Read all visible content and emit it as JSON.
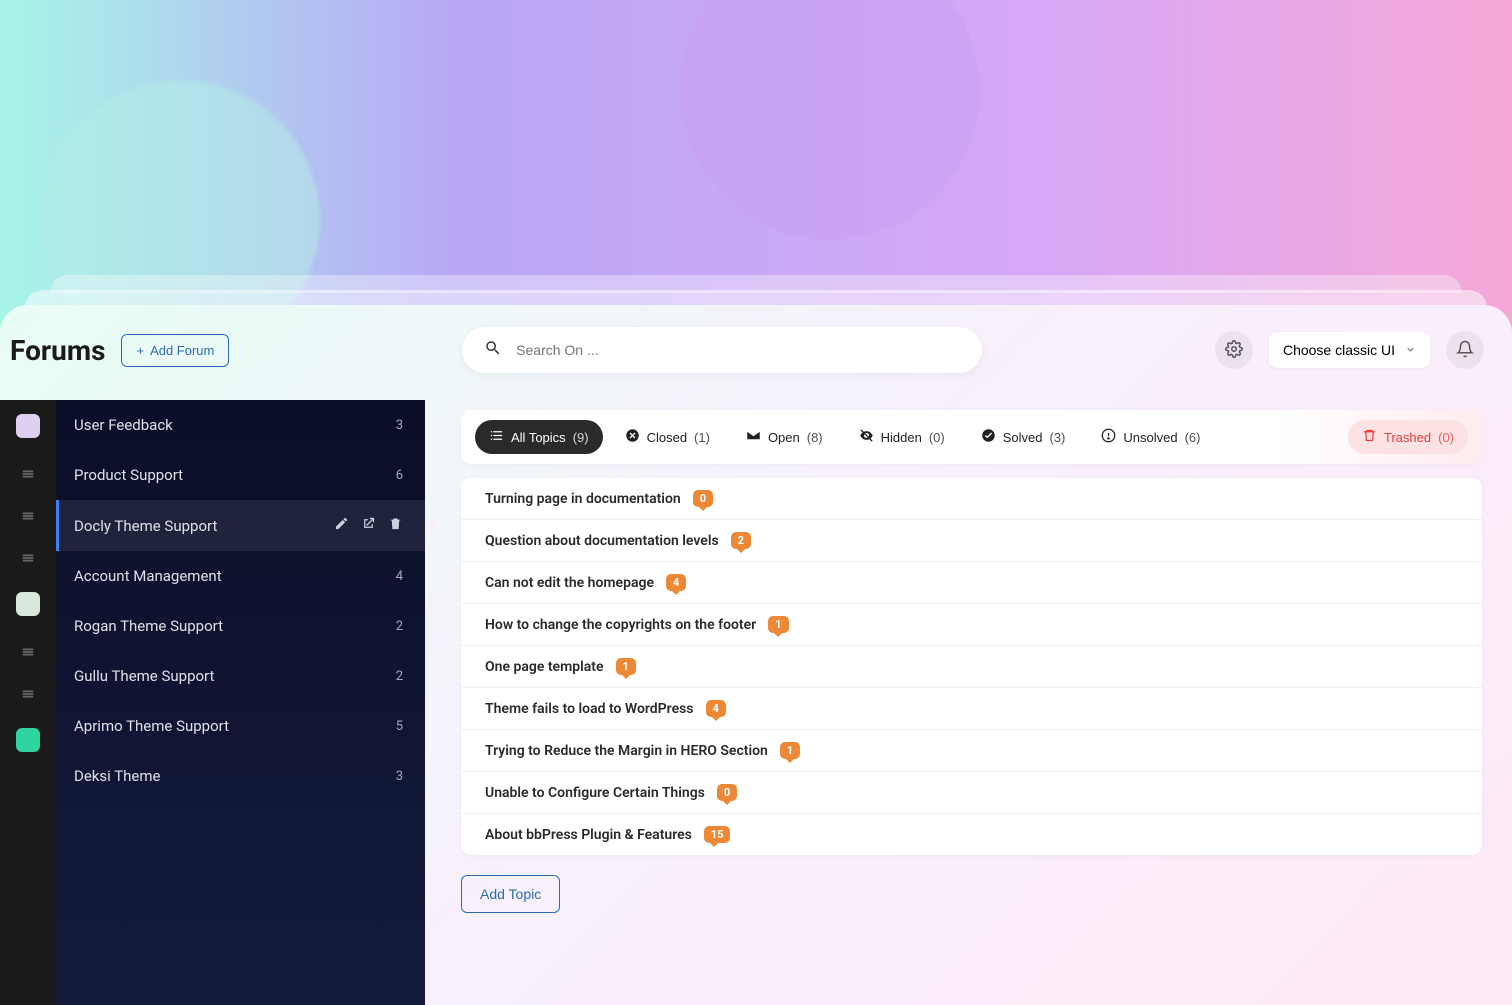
{
  "header": {
    "title": "Forums",
    "add_forum_label": "Add Forum",
    "search": {
      "placeholder": "Search On ..."
    },
    "ui_select_label": "Choose classic UI"
  },
  "sidebar": {
    "items": [
      {
        "label": "User Feedback",
        "count": "3"
      },
      {
        "label": "Product Support",
        "count": "6"
      },
      {
        "label": "Docly Theme Support",
        "count": "",
        "active": true
      },
      {
        "label": "Account Management",
        "count": "4"
      },
      {
        "label": "Rogan Theme Support",
        "count": "2"
      },
      {
        "label": "Gullu Theme Support",
        "count": "2"
      },
      {
        "label": "Aprimo Theme Support",
        "count": "5"
      },
      {
        "label": "Deksi Theme",
        "count": "3"
      }
    ]
  },
  "filters": [
    {
      "key": "all",
      "label": "All Topics",
      "count": "(9)",
      "active": true
    },
    {
      "key": "closed",
      "label": "Closed",
      "count": "(1)"
    },
    {
      "key": "open",
      "label": "Open",
      "count": "(8)"
    },
    {
      "key": "hidden",
      "label": "Hidden",
      "count": "(0)"
    },
    {
      "key": "solved",
      "label": "Solved",
      "count": "(3)"
    },
    {
      "key": "unsolved",
      "label": "Unsolved",
      "count": "(6)"
    },
    {
      "key": "trashed",
      "label": "Trashed",
      "count": "(0)",
      "trash": true
    }
  ],
  "topics": [
    {
      "title": "Turning page in documentation",
      "badge": "0"
    },
    {
      "title": "Question about documentation levels",
      "badge": "2"
    },
    {
      "title": "Can not edit the homepage",
      "badge": "4"
    },
    {
      "title": "How to change the copyrights on the footer",
      "badge": "1"
    },
    {
      "title": "One page template",
      "badge": "1"
    },
    {
      "title": "Theme fails to load to WordPress",
      "badge": "4"
    },
    {
      "title": "Trying to Reduce the Margin in HERO Section",
      "badge": "1"
    },
    {
      "title": "Unable to Configure Certain Things",
      "badge": "0"
    },
    {
      "title": "About bbPress Plugin & Features",
      "badge": "15"
    }
  ],
  "actions": {
    "add_topic_label": "Add Topic"
  }
}
